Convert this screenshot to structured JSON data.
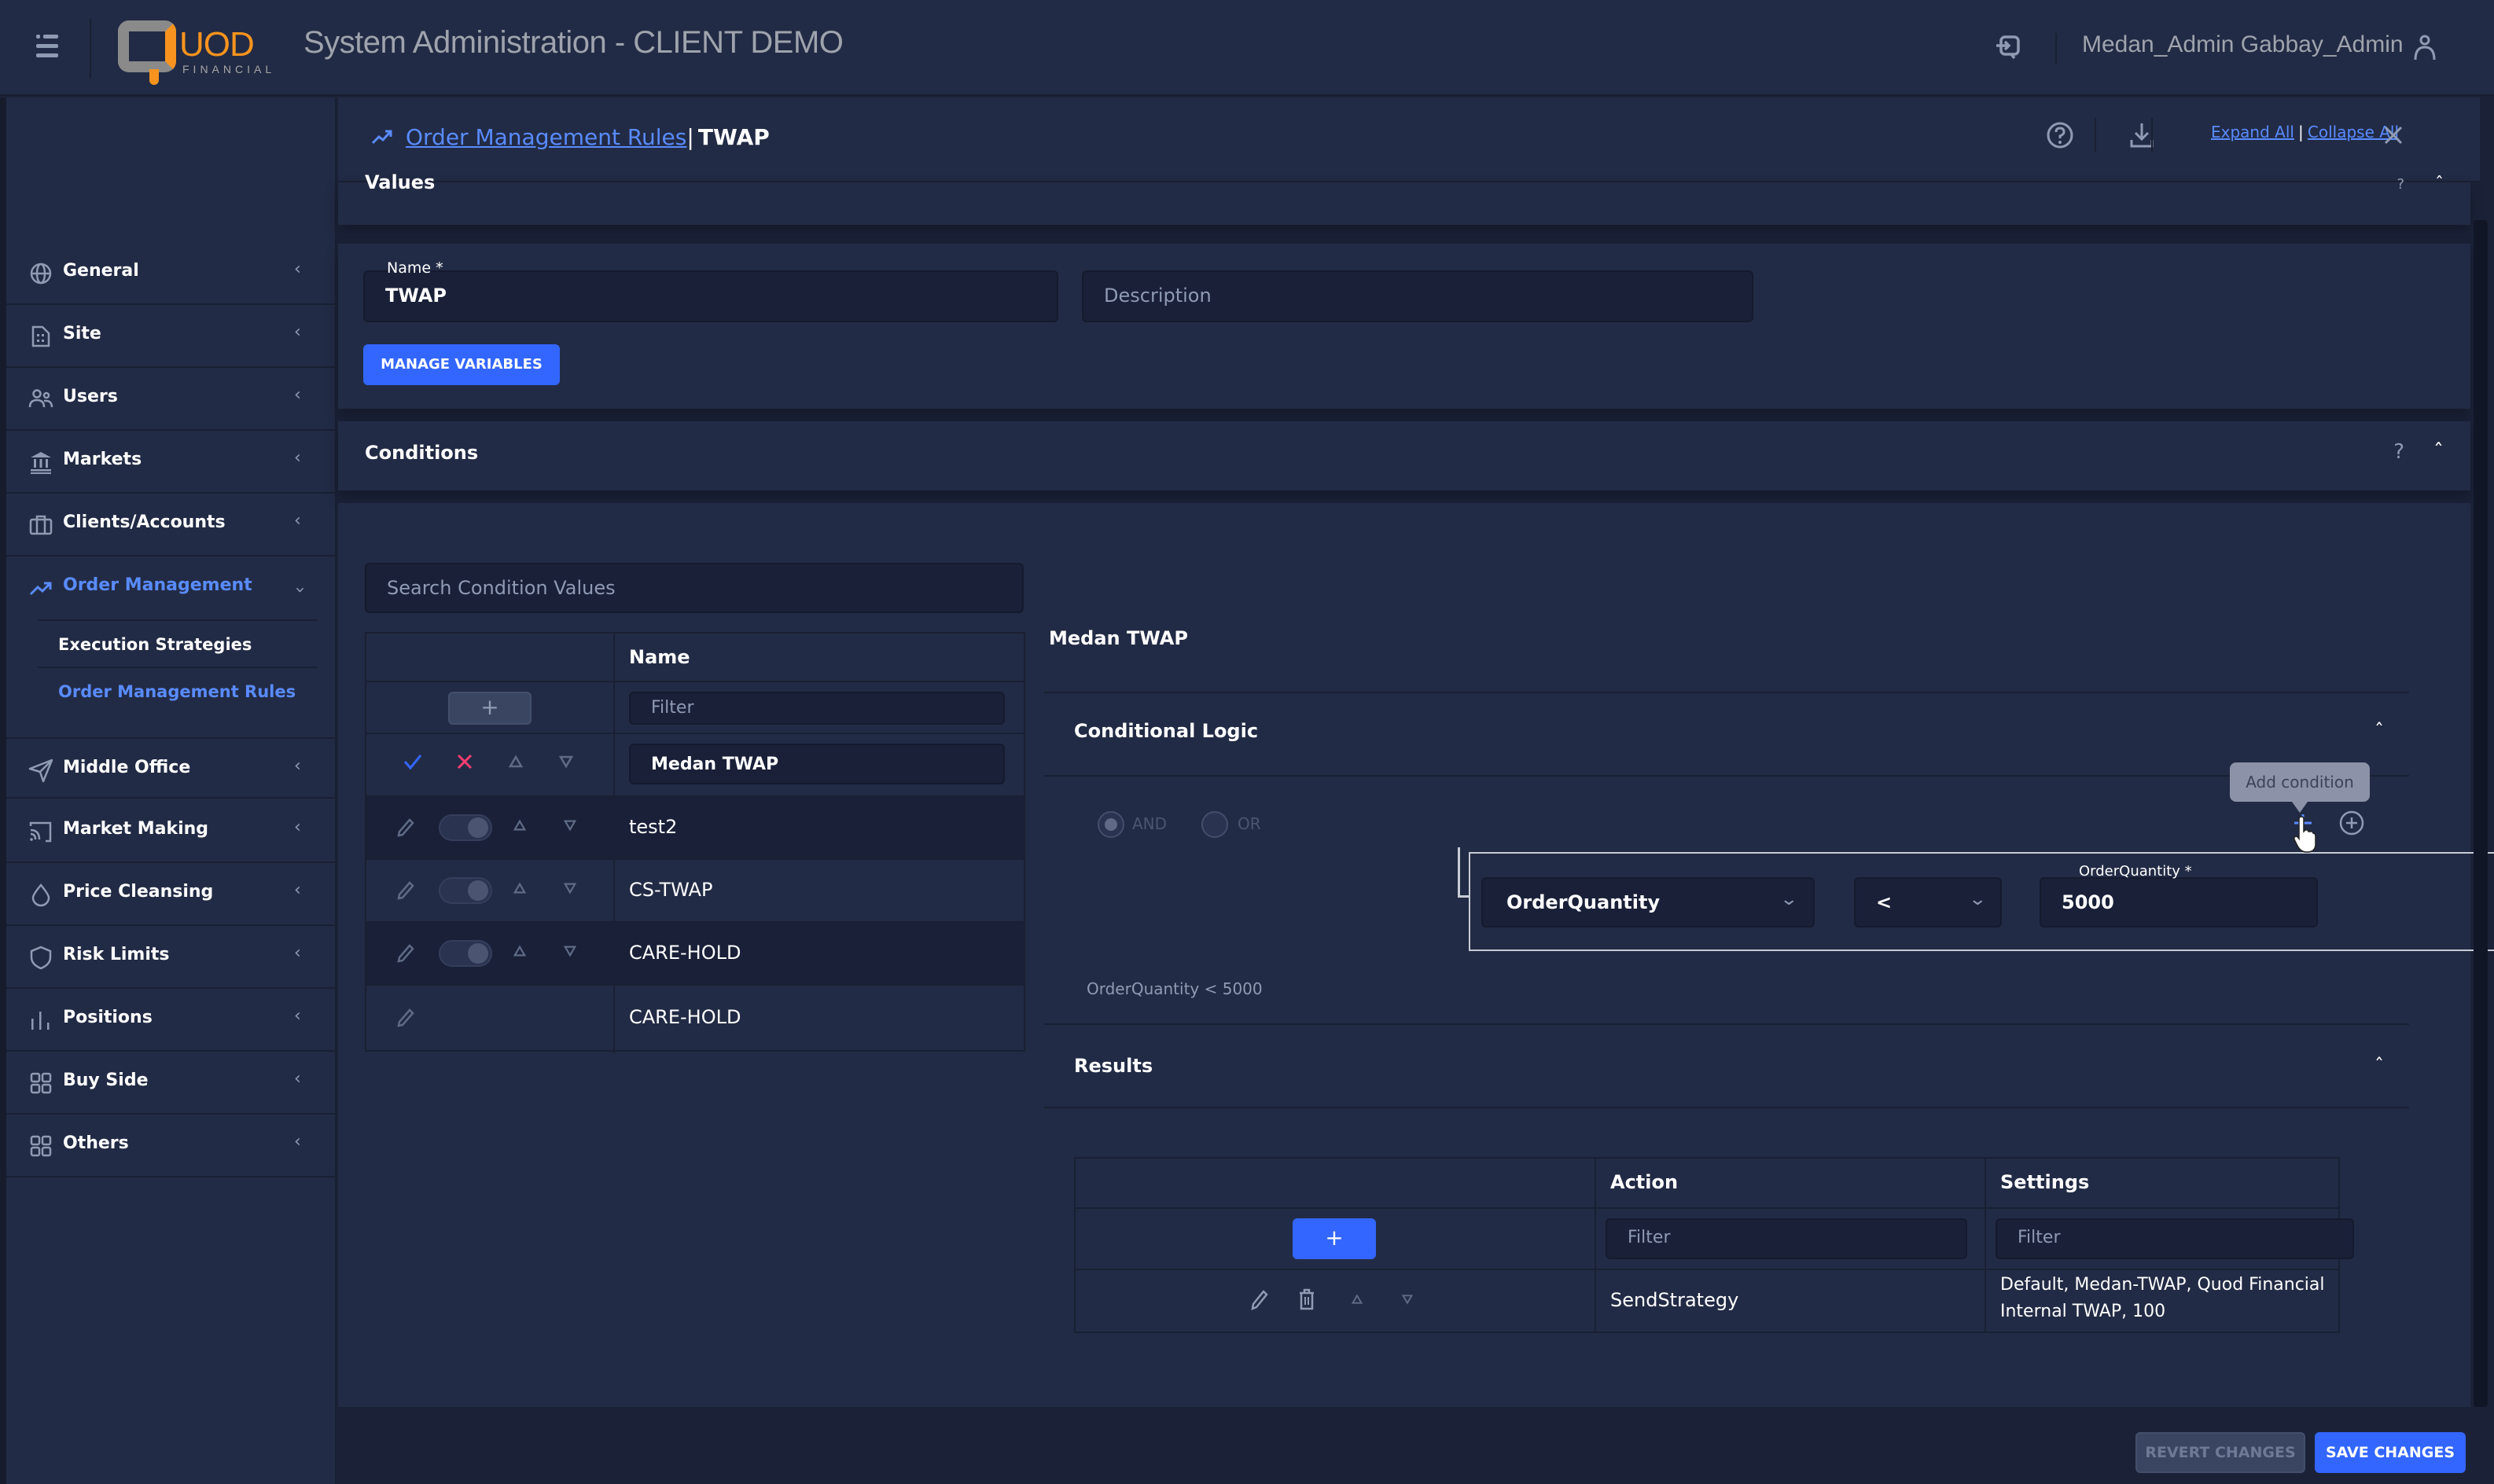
{
  "header": {
    "logo_text": "UOD",
    "logo_subtext": "FINANCIAL",
    "app_title": "System Administration - CLIENT DEMO",
    "user_name": "Medan_Admin Gabbay_Admin"
  },
  "sidebar": {
    "items": [
      {
        "label": "General",
        "icon": "globe-icon"
      },
      {
        "label": "Site",
        "icon": "building-icon"
      },
      {
        "label": "Users",
        "icon": "users-icon"
      },
      {
        "label": "Markets",
        "icon": "bank-icon"
      },
      {
        "label": "Clients/Accounts",
        "icon": "briefcase-icon"
      },
      {
        "label": "Order Management",
        "icon": "trending-up-icon",
        "active": true,
        "expanded": true
      },
      {
        "label": "Middle Office",
        "icon": "send-icon"
      },
      {
        "label": "Market Making",
        "icon": "cast-icon"
      },
      {
        "label": "Price Cleansing",
        "icon": "droplet-icon"
      },
      {
        "label": "Risk Limits",
        "icon": "shield-icon"
      },
      {
        "label": "Positions",
        "icon": "bar-chart-icon"
      },
      {
        "label": "Buy Side",
        "icon": "grid-icon"
      },
      {
        "label": "Others",
        "icon": "grid-icon"
      }
    ],
    "sub_items": [
      {
        "label": "Execution Strategies",
        "active": false
      },
      {
        "label": "Order Management Rules",
        "active": true
      }
    ]
  },
  "page": {
    "breadcrumb_link": "Order Management Rules",
    "breadcrumb_separator": "|",
    "breadcrumb_current": "TWAP",
    "expand_all": "Expand All",
    "link_separator": "|",
    "collapse_all": "Collapse All"
  },
  "values_section": {
    "title": "Values",
    "name_label": "Name *",
    "name_value": "TWAP",
    "description_placeholder": "Description",
    "manage_variables_label": "MANAGE VARIABLES"
  },
  "conditions_section": {
    "title": "Conditions",
    "help": "?",
    "search_placeholder": "Search Condition Values",
    "table": {
      "column_name": "Name",
      "add_button": "+",
      "filter_placeholder": "Filter",
      "editing_row_value": "Medan TWAP",
      "rows": [
        {
          "name": "test2",
          "toggle": true
        },
        {
          "name": "CS-TWAP",
          "toggle": true
        },
        {
          "name": "CARE-HOLD",
          "toggle": true
        },
        {
          "name": "CARE-HOLD",
          "toggle": false
        }
      ]
    },
    "detail": {
      "title": "Medan TWAP",
      "conditional_logic": {
        "title": "Conditional Logic",
        "and_label": "AND",
        "or_label": "OR",
        "selected": "AND",
        "tooltip": "Add condition",
        "condition": {
          "field": "OrderQuantity",
          "operator": "<",
          "value_label": "OrderQuantity *",
          "value": "5000"
        },
        "summary": "OrderQuantity < 5000"
      },
      "results": {
        "title": "Results",
        "add_button": "+",
        "columns": [
          "Action",
          "Settings"
        ],
        "filter_placeholder": "Filter",
        "rows": [
          {
            "action": "SendStrategy",
            "settings_line1": "Default, Medan-TWAP, Quod Financial",
            "settings_line2": "Internal TWAP, 100"
          }
        ]
      }
    }
  },
  "footer": {
    "revert_label": "REVERT CHANGES",
    "save_label": "SAVE CHANGES"
  },
  "colors": {
    "accent": "#3366ff",
    "link": "#598bff",
    "danger": "#ff3d71",
    "brand_orange": "#f7931e",
    "background": "#222b45"
  }
}
